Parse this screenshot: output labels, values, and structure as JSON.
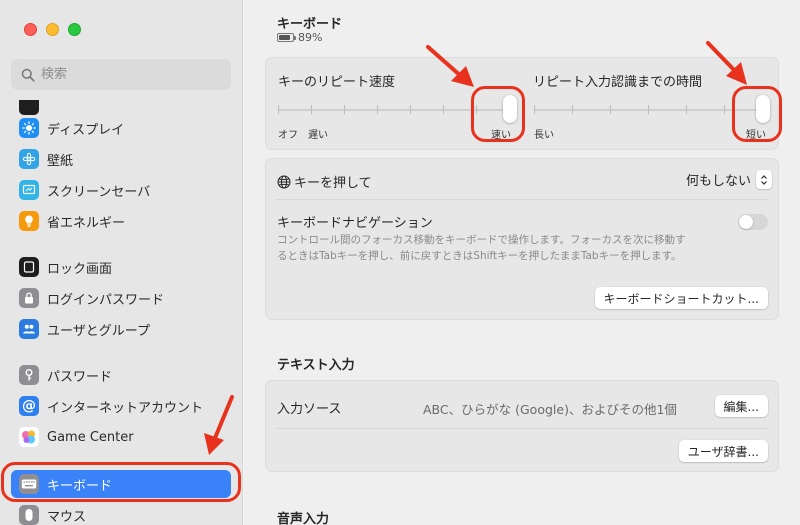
{
  "window": {
    "traffic_lights": [
      "close",
      "minimize",
      "zoom"
    ]
  },
  "sidebar": {
    "search_placeholder": "検索",
    "items": [
      {
        "label": "ディスプレイ",
        "icon": "display-icon",
        "color": "#1f8ff5"
      },
      {
        "label": "壁紙",
        "icon": "wallpaper-icon",
        "color": "#30a4e6"
      },
      {
        "label": "スクリーンセーバ",
        "icon": "screensaver-icon",
        "color": "#31b5e8"
      },
      {
        "label": "省エネルギー",
        "icon": "energy-icon",
        "color": "#f59a0c"
      },
      {
        "label": "ロック画面",
        "icon": "lock-screen-icon",
        "color": "#1e1e1e"
      },
      {
        "label": "ログインパスワード",
        "icon": "login-password-icon",
        "color": "#8f8f93"
      },
      {
        "label": "ユーザとグループ",
        "icon": "users-groups-icon",
        "color": "#2c7be0"
      },
      {
        "label": "パスワード",
        "icon": "key-icon",
        "color": "#8f8f93"
      },
      {
        "label": "インターネットアカウント",
        "icon": "internet-accounts-icon",
        "color": "#2e7ff0"
      },
      {
        "label": "Game Center",
        "icon": "game-center-icon",
        "color": "#ffffff"
      },
      {
        "label": "キーボード",
        "icon": "keyboard-icon",
        "color": "#8f8f93",
        "selected": true
      },
      {
        "label": "マウス",
        "icon": "mouse-icon",
        "color": "#8f8f93"
      }
    ],
    "selected_color": "#3a82f7"
  },
  "main": {
    "title": "キーボード",
    "battery": "89%",
    "repeat_rate": {
      "label": "キーのリピート速度",
      "left_labels": [
        "オフ",
        "遅い"
      ],
      "right_label": "速い",
      "value_fraction": 1.0
    },
    "delay_until_repeat": {
      "label": "リピート入力認識までの時間",
      "left_label": "長い",
      "right_label": "短い",
      "value_fraction": 1.0
    },
    "globe_key": {
      "label": "キーを押して",
      "value": "何もしない"
    },
    "keyboard_navigation": {
      "label": "キーボードナビゲーション",
      "enabled": false,
      "description_line1": "コントロール間のフォーカス移動をキーボードで操作します。フォーカスを次に移動す",
      "description_line2": "るときはTabキーを押し、前に戻すときはShiftキーを押したままTabキーを押します。"
    },
    "shortcuts_button": "キーボードショートカット...",
    "text_input": {
      "section_title": "テキスト入力",
      "input_sources_label": "入力ソース",
      "input_sources_value": "ABC、ひらがな (Google)、およびその他1個",
      "edit_button": "編集...",
      "user_dictionary_button": "ユーザ辞書..."
    },
    "dictation": {
      "section_title": "音声入力"
    }
  },
  "annotation_color": "#e8321d"
}
